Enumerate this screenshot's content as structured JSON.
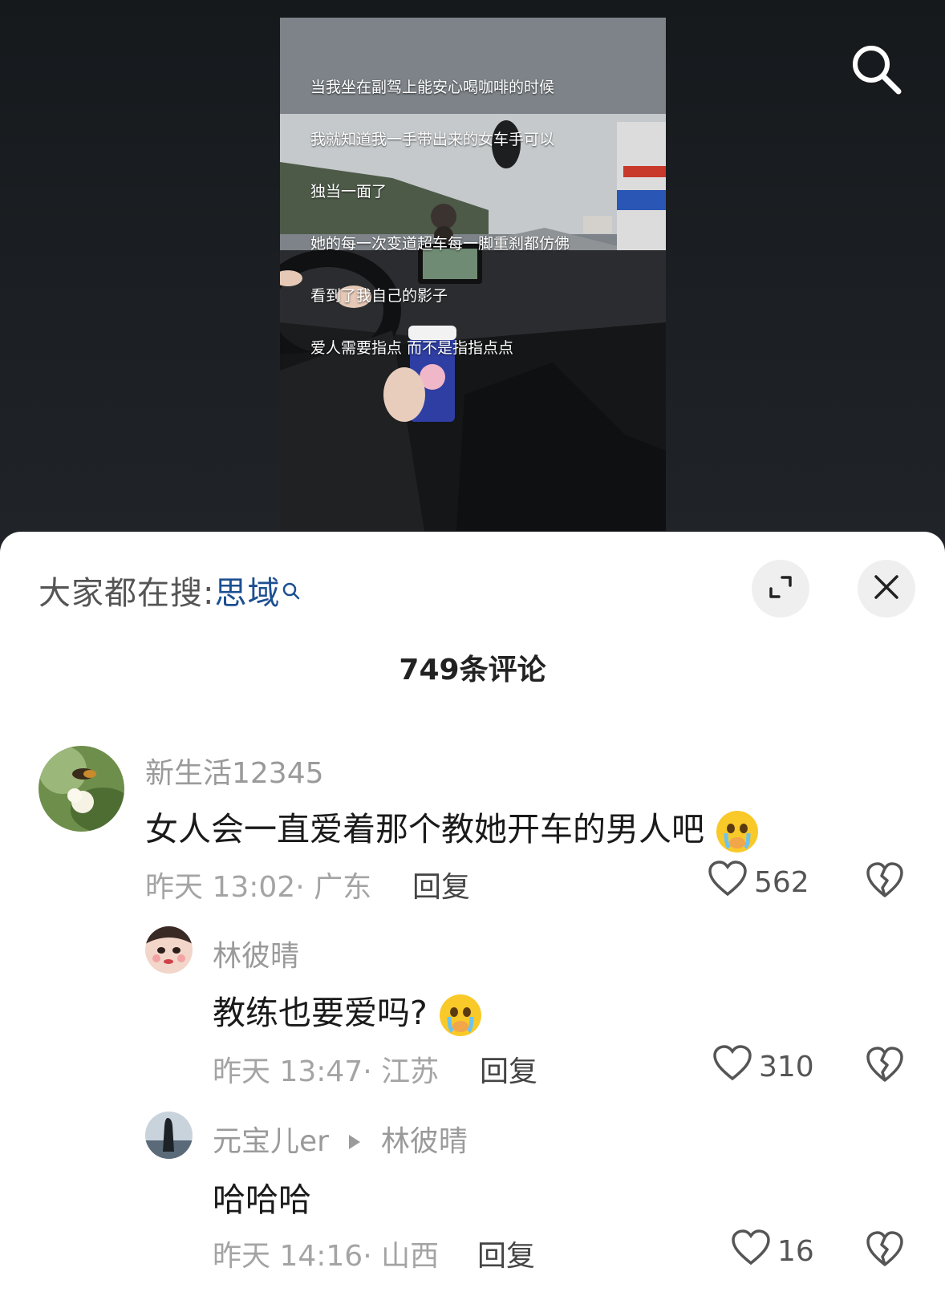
{
  "video": {
    "caption_lines": [
      "当我坐在副驾上能安心喝咖啡的时候",
      "我就知道我一手带出来的女车手可以",
      "独当一面了",
      "她的每一次变道超车每一脚重刹都仿佛",
      "看到了我自己的影子",
      "爱人需要指点 而不是指指点点"
    ],
    "search_icon": "search-icon"
  },
  "sheet": {
    "everyone_label": "大家都在搜:",
    "everyone_keyword": "思域",
    "expand_icon": "expand-icon",
    "close_icon": "close-icon",
    "comment_count": "749条评论"
  },
  "comments": [
    {
      "user": "新生活12345",
      "text": "女人会一直爱着那个教她开车的男人吧",
      "emoji": "crying-face-emoji",
      "meta": "昨天 13:02· 广东",
      "reply": "回复",
      "likes": "562"
    },
    {
      "user": "林彼晴",
      "text": "教练也要爱吗?",
      "emoji": "crying-face-emoji",
      "meta": "昨天 13:47· 江苏",
      "reply": "回复",
      "likes": "310"
    },
    {
      "user": "元宝儿er",
      "reply_to": "林彼晴",
      "text": "哈哈哈",
      "meta": "昨天 14:16· 山西",
      "reply": "回复",
      "likes": "16"
    }
  ],
  "colors": {
    "keyword": "#1d4f91",
    "sheet_bg": "#ffffff",
    "top_bg": "#1b1e21"
  }
}
